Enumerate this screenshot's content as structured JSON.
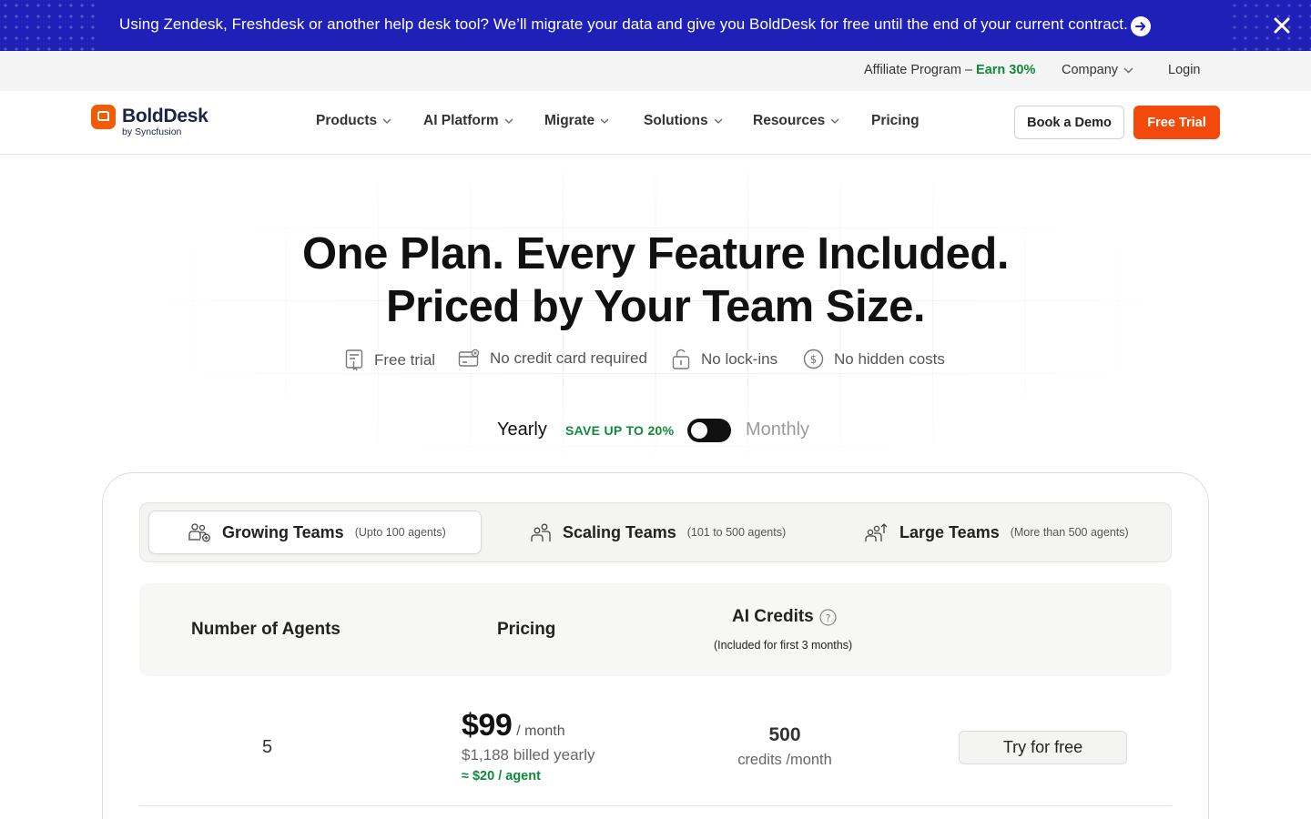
{
  "announcement": {
    "message": "Using Zendesk, Freshdesk or another help desk tool? We’ll migrate your data and give you BoldDesk for free until the end of your current contract.",
    "arrow_icon": "arrow-right-circle-icon",
    "close_icon": "close-icon"
  },
  "utility": {
    "affiliate_label": "Affiliate Program –",
    "affiliate_earn": "Earn 30%",
    "company_label": "Company",
    "login_label": "Login"
  },
  "brand": {
    "name": "BoldDesk",
    "byline": "by Syncfusion",
    "accent_color": "#f25c05"
  },
  "nav": {
    "items": [
      {
        "label": "Products",
        "has_dropdown": true
      },
      {
        "label": "AI Platform",
        "has_dropdown": true
      },
      {
        "label": "Migrate",
        "has_dropdown": true
      },
      {
        "label": "Solutions",
        "has_dropdown": true
      },
      {
        "label": "Resources",
        "has_dropdown": true
      },
      {
        "label": "Pricing",
        "has_dropdown": false
      }
    ],
    "demo_label": "Book a Demo",
    "trial_label": "Free Trial"
  },
  "hero": {
    "title_line1": "One Plan. Every Feature Included.",
    "title_line2": "Priced by Your Team Size.",
    "benefits": [
      {
        "label": "Free trial",
        "icon": "trial-badge-icon"
      },
      {
        "label": "No credit card required",
        "icon": "credit-card-icon"
      },
      {
        "label": "No lock-ins",
        "icon": "unlock-icon"
      },
      {
        "label": "No hidden costs",
        "icon": "dollar-circle-icon"
      }
    ]
  },
  "billing": {
    "yearly_label": "Yearly",
    "save_label": "SAVE UP TO 20%",
    "monthly_label": "Monthly",
    "selected": "Yearly"
  },
  "tabs": [
    {
      "label": "Growing Teams",
      "note": "(Upto 100 agents)",
      "active": true,
      "icon": "team-add-icon"
    },
    {
      "label": "Scaling Teams",
      "note": "(101 to 500 agents)",
      "active": false,
      "icon": "team-scale-icon"
    },
    {
      "label": "Large Teams",
      "note": "(More than 500 agents)",
      "active": false,
      "icon": "team-growth-icon"
    }
  ],
  "table": {
    "headers": {
      "agents": "Number of Agents",
      "pricing": "Pricing",
      "credits": "AI Credits",
      "credits_sub": "(Included for first 3 months)"
    },
    "rows": [
      {
        "agents": "5",
        "price": "$99",
        "price_period": "/ month",
        "billed": "$1,188 billed yearly",
        "per_agent": "≈ $20 / agent",
        "credits": "500",
        "credits_unit": "credits /month",
        "cta": "Try for free"
      }
    ]
  }
}
